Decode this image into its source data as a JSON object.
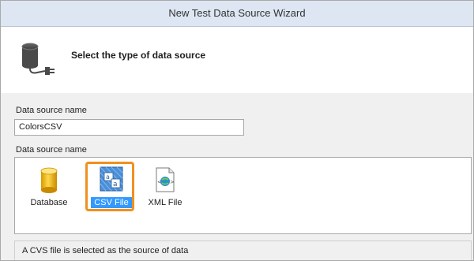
{
  "window": {
    "title": "New Test Data Source Wizard"
  },
  "header": {
    "title": "Select the type of data source",
    "icon": "database-plug-icon"
  },
  "form": {
    "name_label": "Data source name",
    "name_value": "ColorsCSV",
    "types_label": "Data source name"
  },
  "types": [
    {
      "label": "Database",
      "icon": "database-icon",
      "selected": false
    },
    {
      "label": "CSV File",
      "icon": "csv-file-icon",
      "selected": true
    },
    {
      "label": "XML File",
      "icon": "xml-file-icon",
      "selected": false
    }
  ],
  "status": {
    "text": "A CVS file is selected as the source of data"
  },
  "colors": {
    "accent_highlight": "#f0901e",
    "selection": "#3399ff",
    "titlebar": "#dde6f2"
  }
}
